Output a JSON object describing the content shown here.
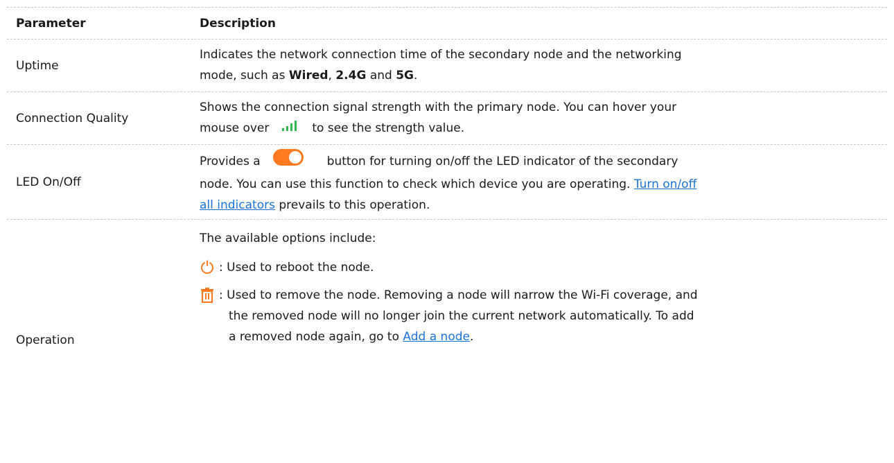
{
  "table": {
    "header": {
      "parameter": "Parameter",
      "description": "Description"
    },
    "uptime": {
      "parameter": "Uptime",
      "desc_line1": "Indicates the network connection time of the secondary node and the networking",
      "desc_line2_pre": "mode, such as ",
      "mode_wired": "Wired",
      "sep_comma": ", ",
      "mode_24g": "2.4G",
      "sep_and": " and ",
      "mode_5g": "5G",
      "end": "."
    },
    "quality": {
      "parameter": "Connection Quality",
      "desc_line1": "Shows the connection signal strength with the primary node. You can hover your",
      "desc_line2_pre": "mouse over",
      "desc_line2_post": "to see the strength value.",
      "signal_icon": "signal-strength-icon",
      "signal_color": "#2dbb4e"
    },
    "led": {
      "parameter": "LED On/Off",
      "desc_pre": "Provides a",
      "desc_post": "button for turning on/off the LED indicator of the secondary",
      "desc_line2": "node. You can use this function to check which device you are operating.",
      "link_text_1": "Turn on/off",
      "link_text_2": "all indicators",
      "desc_line3_post": " prevails to this operation.",
      "toggle_icon": "toggle-switch-icon",
      "toggle_color": "#ff7a1f"
    },
    "operation": {
      "parameter": "Operation",
      "intro": "The available options include:",
      "reboot_icon": "power-icon",
      "reboot_text": ": Used to reboot the node.",
      "remove_icon": "trash-icon",
      "remove_text_line1": ": Used to remove the node. Removing a node will narrow the Wi-Fi coverage, and",
      "remove_text_line2": "the removed node will no longer join the current network automatically. To add",
      "remove_text_line3_pre": "a removed node again, go to ",
      "remove_link": "Add a node",
      "remove_end": ".",
      "icon_color": "#ff7a1f"
    }
  }
}
